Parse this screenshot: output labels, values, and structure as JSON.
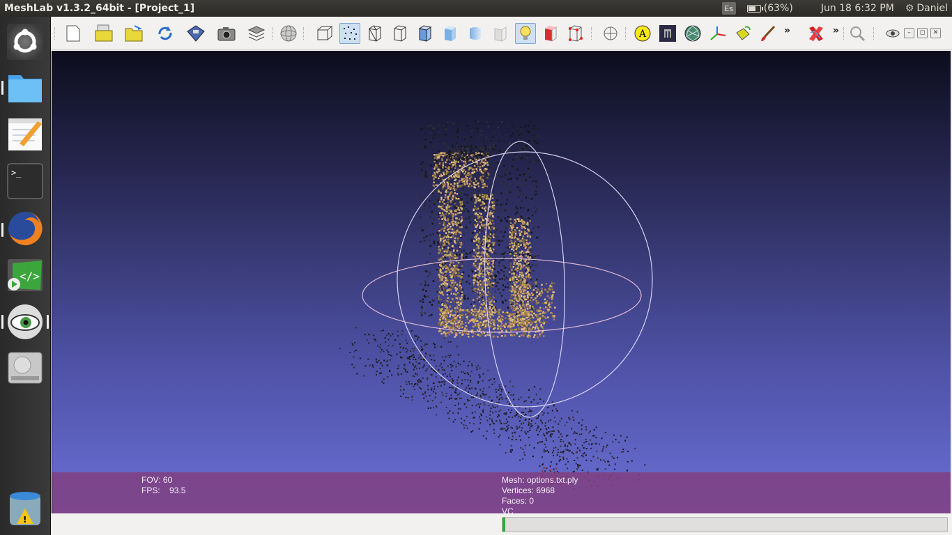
{
  "window": {
    "title": "MeshLab v1.3.2_64bit - [Project_1]"
  },
  "panel": {
    "keyboard_layout": "Es",
    "battery_label": "(63%)",
    "battery_level": 0.63,
    "datetime": "Jun 18  6:32 PM",
    "user": "Daniel"
  },
  "launcher": {
    "items": [
      "ubuntu-dash",
      "files",
      "text-editor",
      "terminal",
      "firefox",
      "code-editor",
      "meshlab",
      "disk-drive",
      "trash"
    ]
  },
  "toolbar": {
    "more_glyph": "»",
    "buttons": [
      "new-project",
      "open-project",
      "import-mesh",
      "reload",
      "save-snapshot",
      "take-screenshot",
      "show-layers",
      "bounding-box",
      "points",
      "wireframe",
      "hidden-lines",
      "flat-lines",
      "flat",
      "smooth",
      "texture",
      "light",
      "back-face",
      "selected-faces",
      "trackball",
      "annotation",
      "raster",
      "quality-mapper",
      "manipulator",
      "paint",
      "brush",
      "delete-selection",
      "zoom",
      "fullscreen"
    ]
  },
  "viewport": {
    "fov_label": "FOV:",
    "fov_value": "60",
    "fps_label": "FPS:",
    "fps_value": "93.5",
    "mesh_line": "Mesh: options.txt.ply",
    "vertices_line": "Vertices: 6968",
    "faces_line": "Faces: 0",
    "mode_line": "VC",
    "background_top": "#0d0d1e",
    "background_bottom": "#6b6fd6",
    "info_band_color": "#804080"
  },
  "status": {
    "progress": 0.006
  }
}
